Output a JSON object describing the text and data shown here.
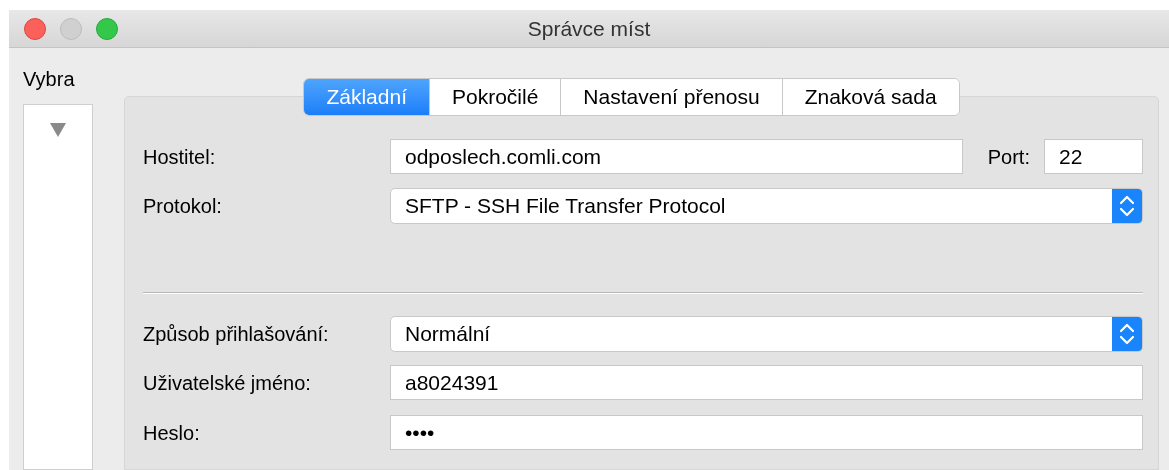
{
  "window": {
    "title": "Správce míst"
  },
  "sidebar": {
    "label": "Vybra",
    "tree_expanded": true
  },
  "tabs": [
    {
      "label": "Základní",
      "selected": true
    },
    {
      "label": "Pokročilé",
      "selected": false
    },
    {
      "label": "Nastavení přenosu",
      "selected": false
    },
    {
      "label": "Znaková sada",
      "selected": false
    }
  ],
  "host": {
    "label": "Hostitel:",
    "value": "odposlech.comli.com"
  },
  "port": {
    "label": "Port:",
    "value": "22"
  },
  "protocol": {
    "label": "Protokol:",
    "value": "SFTP - SSH File Transfer Protocol"
  },
  "logon_type": {
    "label": "Způsob přihlašování:",
    "value": "Normální"
  },
  "user": {
    "label": "Uživatelské jméno:",
    "value": "a8024391"
  },
  "password": {
    "label": "Heslo:",
    "value": "••••"
  }
}
